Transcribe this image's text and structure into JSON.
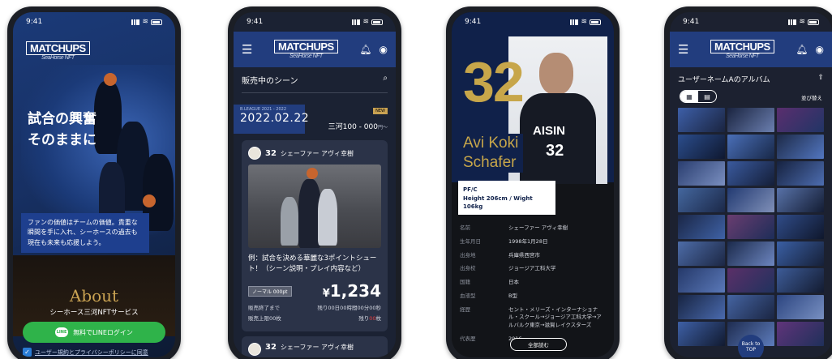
{
  "status": {
    "time": "9:41"
  },
  "brand": {
    "logo": "MATCHUPS",
    "sub": "SeaHorse NFT"
  },
  "phone1": {
    "headline_line1": "試合の興奮",
    "headline_line2": "そのままに",
    "caption": "ファンの価値はチームの価値。貴重な瞬間を手に入れ、シーホースの過去も現在も未来も応援しよう。",
    "about_title": "About",
    "about_sub": "シーホース三河NFTサービス",
    "line_icon": "LINE",
    "line_button": "無料でLINEログイン",
    "terms": "ユーザー規約とプライバシーポリシーに同意"
  },
  "phone2": {
    "section_title": "販売中のシーン",
    "league": "B.LEAGUE 2021 - 2022",
    "date": "2022.02.22",
    "new_badge": "NEW",
    "price_range": "三河100 - 000",
    "price_range_unit": "円～",
    "scene_number": "32",
    "scene_player": "シェーファー アヴィ幸樹",
    "scene_title": "例：試合を決める華麗な3ポイントシュート！（シーン説明・プレイ内容など）",
    "normal_badge": "ノーマル 000pt",
    "price_symbol": "¥",
    "price_value": "1,234",
    "end_label": "販売終了まで",
    "remaining_time": "残り00日00時間00分00秒",
    "limit_label": "販売上限00枚",
    "remaining_pre": "残り",
    "remaining_count": "00",
    "remaining_post": "枚",
    "scene2_number": "32",
    "scene2_player": "シェーファー アヴィ幸樹"
  },
  "phone3": {
    "number": "32",
    "name_line1": "Avi Koki",
    "name_line2": "Schafer",
    "position": "PF/C",
    "body": "Height 206cm / Wight 106kg",
    "profile": [
      {
        "k": "名前",
        "v": "シェーファー アヴィ幸樹"
      },
      {
        "k": "生年月日",
        "v": "1998年1月28日"
      },
      {
        "k": "出身地",
        "v": "兵庫県西宮市"
      },
      {
        "k": "出身校",
        "v": "ジョージア工科大学"
      },
      {
        "k": "国籍",
        "v": "日本"
      },
      {
        "k": "血液型",
        "v": "B型"
      },
      {
        "k": "経歴",
        "v": "セント・メリーズ・インターナショナル・スクール→ジョージア工科大学→アルバルク東京→滋賀レイクスターズ"
      },
      {
        "k": "代表歴",
        "v": "2016"
      }
    ],
    "read_more": "全部読む"
  },
  "phone4": {
    "album_title": "ユーザーネームAのアルバム",
    "sort_label": "並び替え",
    "back_to_top_line1": "Back to",
    "back_to_top_line2": "TOP"
  }
}
